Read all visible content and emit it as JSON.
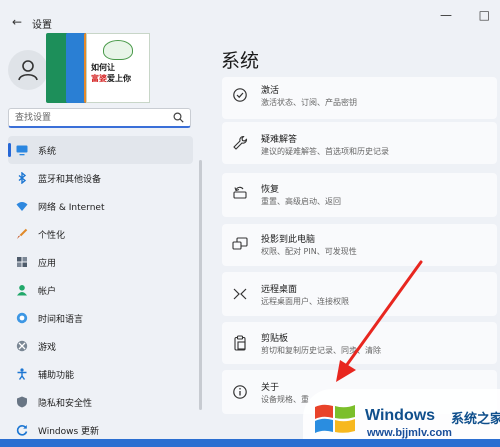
{
  "window": {
    "title": "设置",
    "back_glyph": "←",
    "minimize_glyph": "—",
    "maximize_glyph": "□"
  },
  "profile": {
    "book_cover_lines": [
      "如何让",
      "富婆",
      "爱上你"
    ]
  },
  "search": {
    "placeholder": "查找设置"
  },
  "sidebar": {
    "items": [
      {
        "label": "系统",
        "icon": "display-icon",
        "selected": true
      },
      {
        "label": "蓝牙和其他设备",
        "icon": "bluetooth-icon"
      },
      {
        "label": "网络 & Internet",
        "icon": "wifi-icon"
      },
      {
        "label": "个性化",
        "icon": "brush-icon"
      },
      {
        "label": "应用",
        "icon": "apps-icon"
      },
      {
        "label": "帐户",
        "icon": "person-icon"
      },
      {
        "label": "时间和语言",
        "icon": "globe-clock-icon"
      },
      {
        "label": "游戏",
        "icon": "xbox-icon"
      },
      {
        "label": "辅助功能",
        "icon": "accessibility-icon"
      },
      {
        "label": "隐私和安全性",
        "icon": "shield-icon"
      },
      {
        "label": "Windows 更新",
        "icon": "update-icon"
      }
    ]
  },
  "main": {
    "title": "系统",
    "cards": [
      {
        "title": "激活",
        "subtitle": "激活状态、订阅、产品密钥",
        "icon": "check-circle-icon"
      },
      {
        "title": "疑难解答",
        "subtitle": "建议的疑难解答、首选项和历史记录",
        "icon": "wrench-icon"
      },
      {
        "title": "恢复",
        "subtitle": "重置、高级启动、返回",
        "icon": "recovery-icon"
      },
      {
        "title": "投影到此电脑",
        "subtitle": "权限、配对 PIN、可发现性",
        "icon": "project-icon"
      },
      {
        "title": "远程桌面",
        "subtitle": "远程桌面用户、连接权限",
        "icon": "remote-desktop-icon"
      },
      {
        "title": "剪贴板",
        "subtitle": "剪切和复制历史记录、同步、清除",
        "icon": "clipboard-icon"
      },
      {
        "title": "关于",
        "subtitle": "设备规格、重",
        "icon": "info-icon"
      }
    ]
  },
  "watermark": {
    "brand": "Windows",
    "brand_cn": "系统之家",
    "url": "www.bjjmlv.com"
  },
  "colors": {
    "accent": "#2667d6",
    "arrow": "#e8261f"
  }
}
